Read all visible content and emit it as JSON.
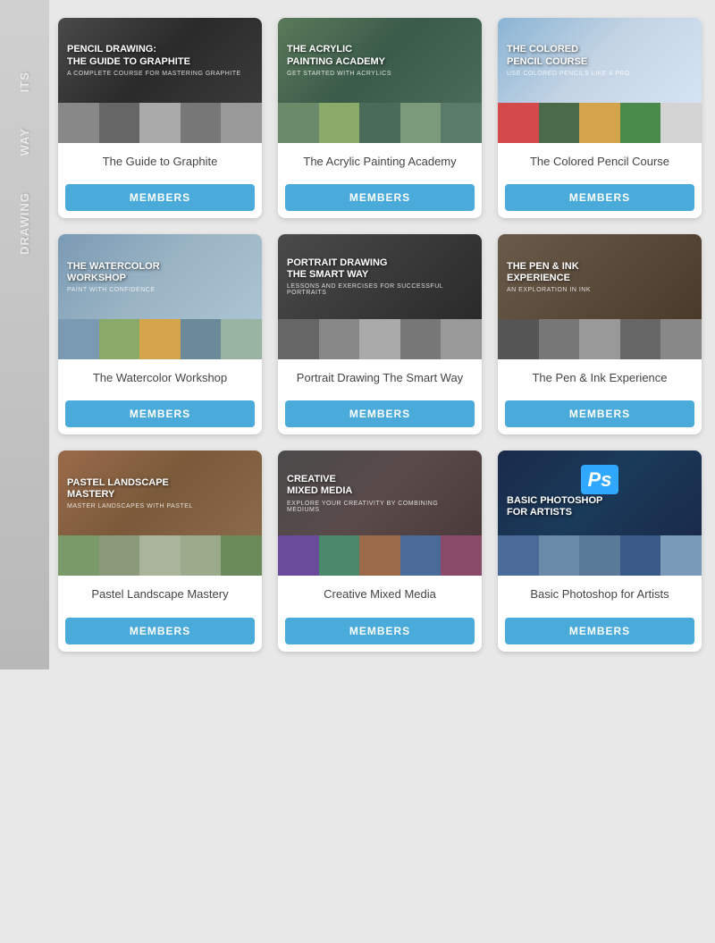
{
  "courses": [
    {
      "id": "graphite",
      "title_line1": "PENCIL DRAWING:",
      "title_line2": "THE GUIDE TO GRAPHITE",
      "subtitle": "A COMPLETE COURSE FOR MASTERING GRAPHITE",
      "name": "The Guide to Graphite",
      "bg_class": "bg-graphite",
      "strip_classes": [
        "graphite-s1",
        "graphite-s2",
        "graphite-s3",
        "graphite-s4",
        "graphite-s5"
      ],
      "btn_label": "MEMBERS"
    },
    {
      "id": "acrylic",
      "title_line1": "THE ACRYLIC",
      "title_line2": "PAINTING ACADEMY",
      "subtitle": "GET STARTED WITH ACRYLICS",
      "name": "The Acrylic Painting Academy",
      "bg_class": "bg-acrylic",
      "strip_classes": [
        "acrylic-s1",
        "acrylic-s2",
        "acrylic-s3",
        "acrylic-s4",
        "acrylic-s5"
      ],
      "btn_label": "MEMBERS"
    },
    {
      "id": "colored-pencil",
      "title_line1": "THE COLORED",
      "title_line2": "PENCIL COURSE",
      "subtitle": "USE COLORED PENCILS LIKE A PRO",
      "name": "The Colored Pencil Course",
      "bg_class": "bg-colored-pencil",
      "strip_classes": [
        "cp-s1",
        "cp-s2",
        "cp-s3",
        "cp-s4",
        "cp-s5"
      ],
      "btn_label": "MEMBERS"
    },
    {
      "id": "watercolor",
      "title_line1": "THE WATERCOLOR",
      "title_line2": "WORKSHOP",
      "subtitle": "PAINT WITH CONFIDENCE",
      "name": "The Watercolor Workshop",
      "bg_class": "bg-watercolor",
      "strip_classes": [
        "wc-s1",
        "wc-s2",
        "wc-s3",
        "wc-s4",
        "wc-s5"
      ],
      "btn_label": "MEMBERS"
    },
    {
      "id": "portrait",
      "title_line1": "PORTRAIT DRAWING",
      "title_line2": "THE SMART WAY",
      "subtitle": "LESSONS AND EXERCISES FOR SUCCESSFUL PORTRAITS",
      "name": "Portrait Drawing The Smart Way",
      "bg_class": "bg-portrait",
      "strip_classes": [
        "portrait-s1",
        "portrait-s2",
        "portrait-s3",
        "portrait-s4",
        "portrait-s5"
      ],
      "btn_label": "MEMBERS"
    },
    {
      "id": "pen-ink",
      "title_line1": "THE PEN & INK",
      "title_line2": "EXPERIENCE",
      "subtitle": "AN EXPLORATION IN INK",
      "name": "The Pen & Ink Experience",
      "bg_class": "bg-pen-ink",
      "strip_classes": [
        "ink-s1",
        "ink-s2",
        "ink-s3",
        "ink-s4",
        "ink-s5"
      ],
      "btn_label": "MEMBERS"
    },
    {
      "id": "pastel",
      "title_line1": "PASTEL LANDSCAPE",
      "title_line2": "MASTERY",
      "subtitle": "MASTER LANDSCAPES WITH PASTEL",
      "name": "Pastel Landscape Mastery",
      "bg_class": "bg-pastel",
      "strip_classes": [
        "pastel-s1",
        "pastel-s2",
        "pastel-s3",
        "pastel-s4",
        "pastel-s5"
      ],
      "btn_label": "MEMBERS"
    },
    {
      "id": "mixed-media",
      "title_line1": "CREATIVE",
      "title_line2": "MIXED MEDIA",
      "subtitle": "EXPLORE YOUR CREATIVITY BY COMBINING MEDIUMS",
      "name": "Creative Mixed Media",
      "bg_class": "bg-mixed-media",
      "strip_classes": [
        "mm-s1",
        "mm-s2",
        "mm-s3",
        "mm-s4",
        "mm-s5"
      ],
      "btn_label": "MEMBERS"
    },
    {
      "id": "photoshop",
      "title_line1": "BASIC PHOTOSHOP",
      "title_line2": "FOR ARTISTS",
      "subtitle": "",
      "name": "Basic Photoshop for Artists",
      "bg_class": "bg-photoshop",
      "strip_classes": [
        "ps-s1",
        "ps-s2",
        "ps-s3",
        "ps-s4",
        "ps-s5"
      ],
      "btn_label": "MEMBERS",
      "is_photoshop": true
    }
  ],
  "side_text_1": "ITS",
  "side_text_2": "WAY",
  "side_text_3": "DRAWING"
}
